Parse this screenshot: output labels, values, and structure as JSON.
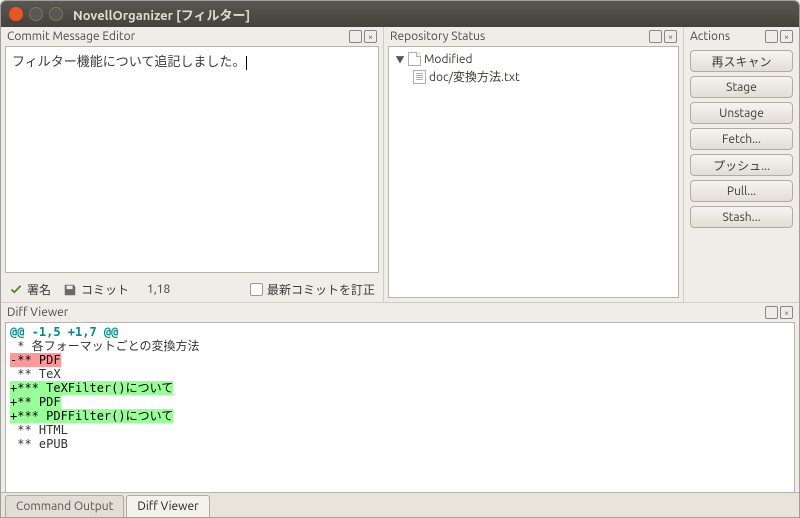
{
  "window": {
    "title": "NovellOrganizer [フィルター]"
  },
  "commit": {
    "title": "Commit Message Editor",
    "message": "フィルター機能について追記しました。",
    "sign_label": "署名",
    "commit_label": "コミット",
    "position": "1,18",
    "amend_label": "最新コミットを訂正"
  },
  "repo": {
    "title": "Repository Status",
    "group_label": "Modified",
    "file_label": "doc/変換方法.txt"
  },
  "actions": {
    "title": "Actions",
    "buttons": {
      "rescan": "再スキャン",
      "stage": "Stage",
      "unstage": "Unstage",
      "fetch": "Fetch...",
      "push": "プッシュ...",
      "pull": "Pull...",
      "stash": "Stash..."
    }
  },
  "diff": {
    "title": "Diff Viewer",
    "hunk": "@@ -1,5 +1,7 @@",
    "l1": " * 各フォーマットごとの変換方法",
    "l2": "-** PDF",
    "l3": " ** TeX",
    "l4": "+*** TeXFilter()について",
    "l5": "+** PDF",
    "l6": "+*** PDFFilter()について",
    "l7": " ** HTML",
    "l8": " ** ePUB"
  },
  "tabs": {
    "command_output": "Command Output",
    "diff_viewer": "Diff Viewer"
  }
}
